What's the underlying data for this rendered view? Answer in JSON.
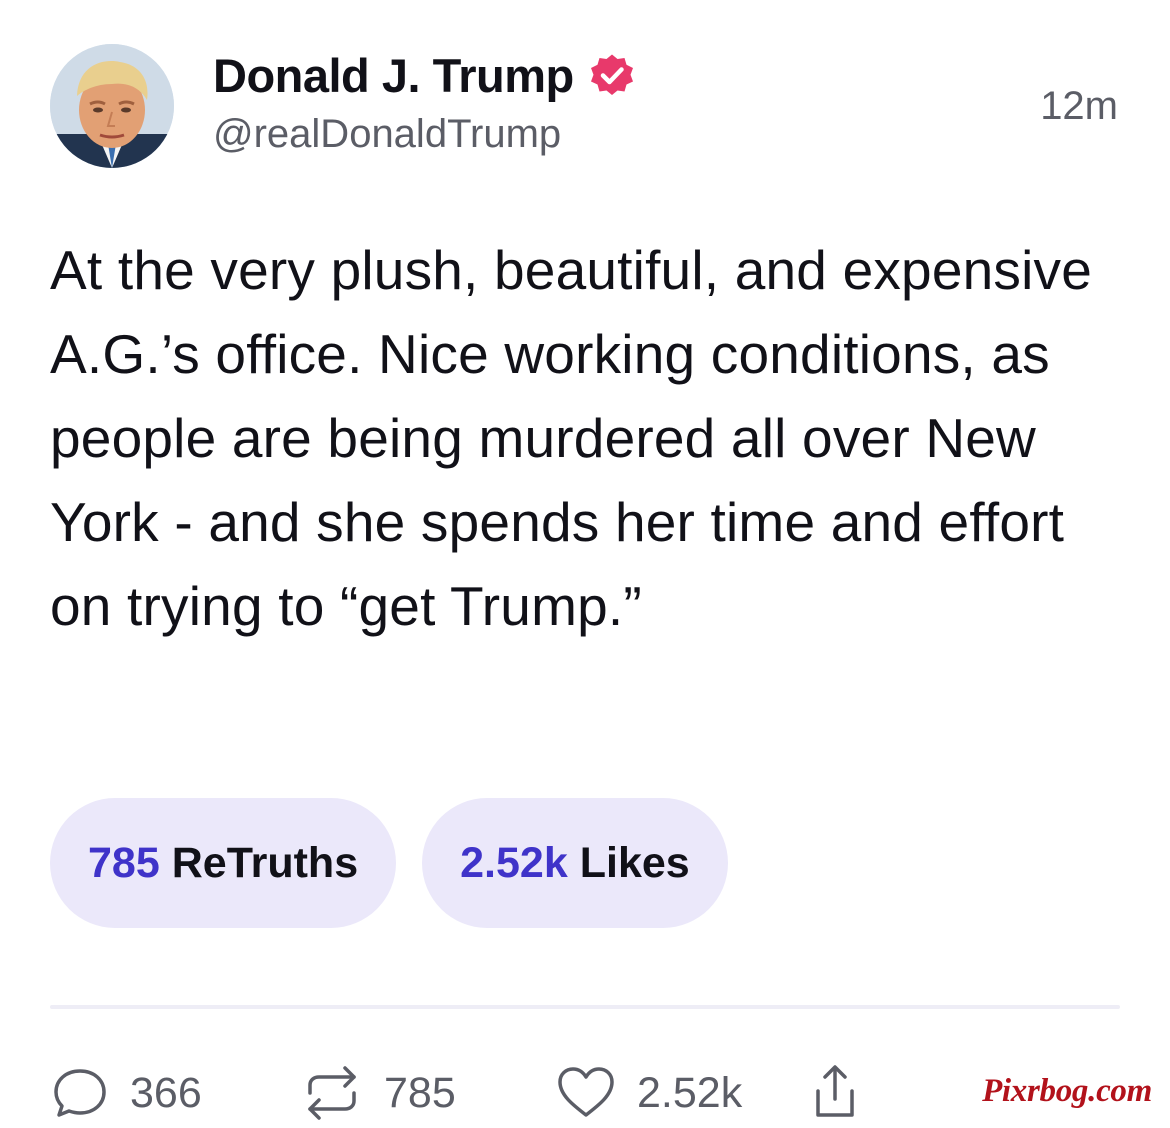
{
  "post": {
    "author": {
      "display_name": "Donald J. Trump",
      "handle": "@realDonaldTrump",
      "verified_icon": "verified-badge-icon",
      "verified_color": "#e8396b"
    },
    "timestamp": "12m",
    "text": "At the very plush, beautiful, and expensive A.G.’s office. Nice working conditions, as people are being murdered all over New York - and she spends her time and effort on trying to “get Trump.”",
    "stats": {
      "retruths_count": "785",
      "retruths_label": "ReTruths",
      "likes_count": "2.52k",
      "likes_label": "Likes"
    },
    "actions": {
      "replies": "366",
      "retruths": "785",
      "likes": "2.52k"
    }
  },
  "watermark": "Pixrbog.com",
  "colors": {
    "accent": "#3f33c9",
    "pill_background": "#ebe8fa",
    "muted_text": "#5b5d66"
  }
}
